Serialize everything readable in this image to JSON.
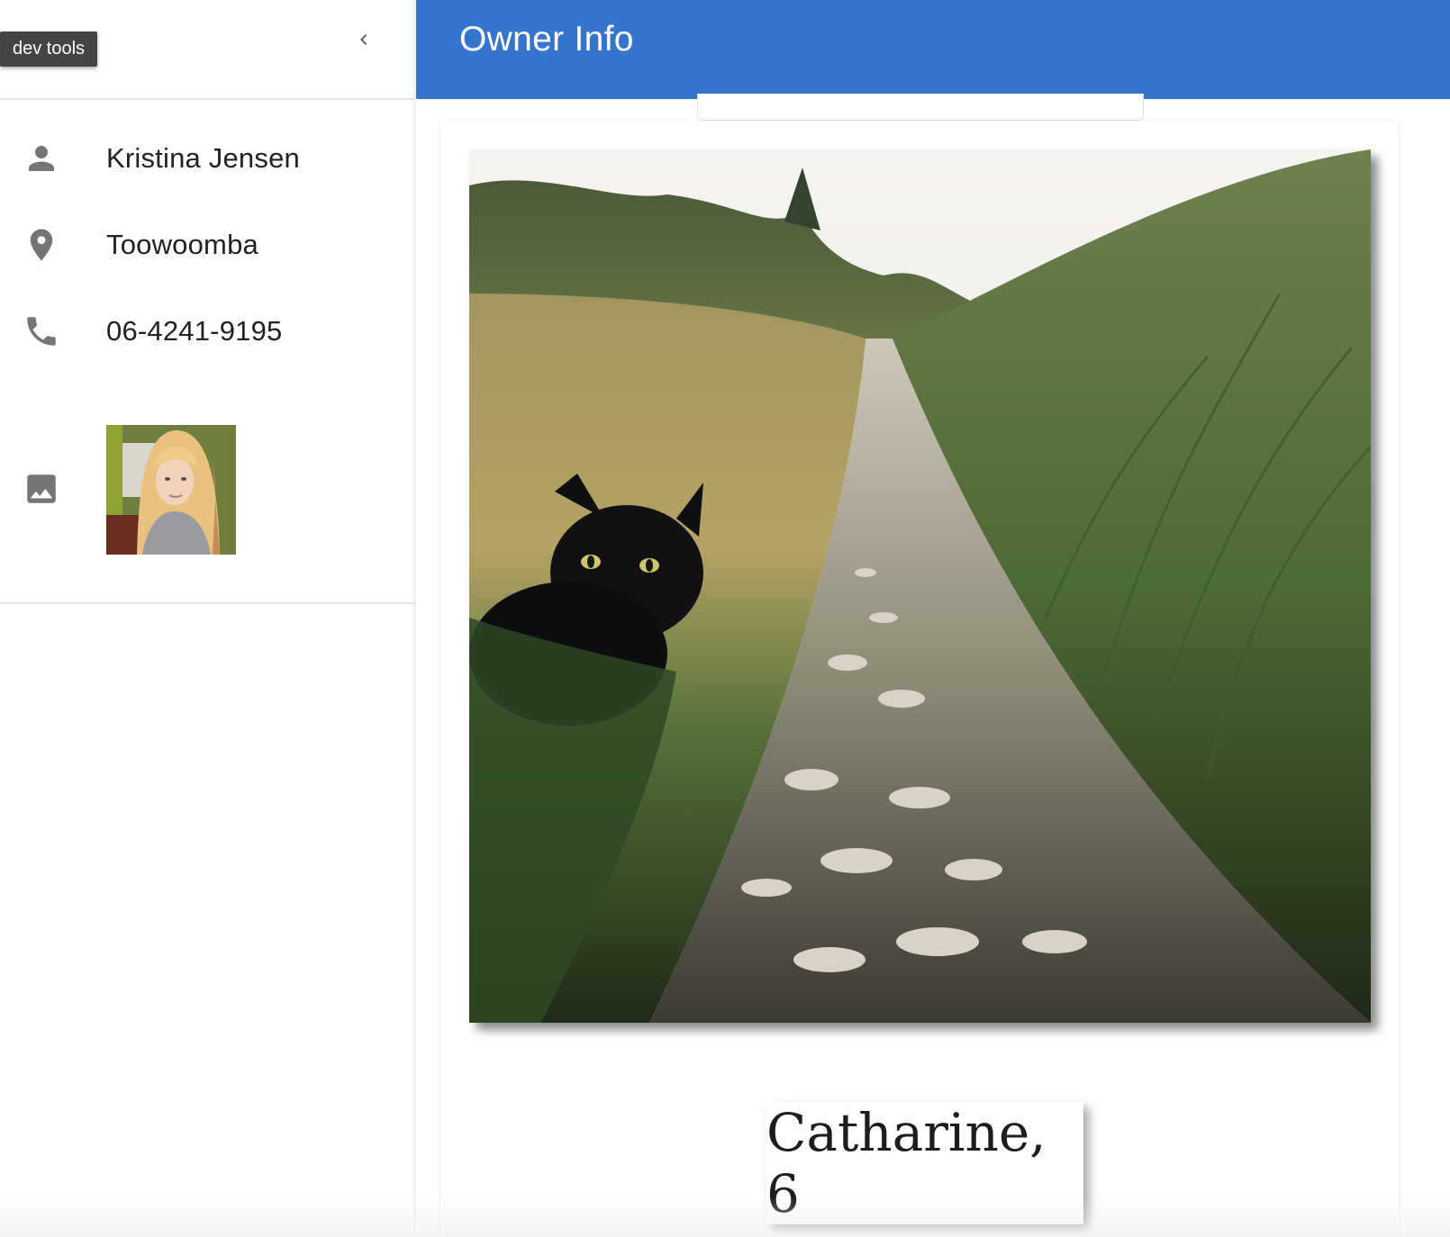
{
  "devtools": {
    "label": "dev tools"
  },
  "appbar": {
    "title": "Owner Info"
  },
  "owner": {
    "name": "Kristina Jensen",
    "city": "Toowoomba",
    "phone": "06-4241-9195"
  },
  "pet": {
    "caption": "Catharine, 6"
  },
  "colors": {
    "appbar": "#3575cd",
    "icon": "#757575",
    "tooltip": "#444444"
  },
  "icons": {
    "collapse": "chevron-left-icon",
    "name": "person-icon",
    "city": "location-pin-icon",
    "phone": "phone-icon",
    "photo": "image-icon"
  }
}
